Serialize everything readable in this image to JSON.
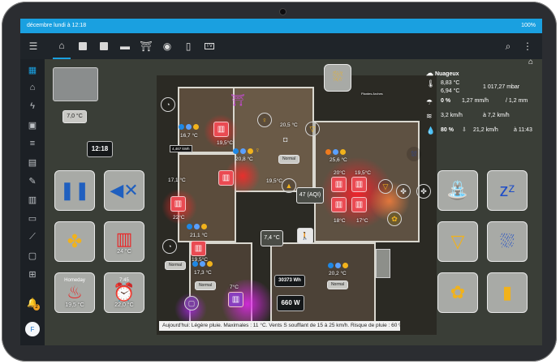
{
  "status": {
    "time_text": "décembre lundi à 12:18",
    "battery": "100%"
  },
  "weather": {
    "condition": "Nuageux",
    "temp_out": "8,83 °C",
    "dew_point": "6,94 °C",
    "pressure": "1 017,27 mbar",
    "rain_prob": "0 %",
    "rain_rate": "1,27 mm/h",
    "rain_total": "/ 1,2 mm",
    "wind": "3,2 km/h",
    "gust": "à 7,2 km/h",
    "humidity": "80 %",
    "wind_max": "21,2 km/h",
    "wind_max_time": "à 11:43"
  },
  "left": {
    "camera_temp": "7,0 °C",
    "clock": "12:18",
    "radiator_temp": "24 °C",
    "homeday_label": "Homeday",
    "homeday_temp": "19,5 °C",
    "alarm_time": "7:45",
    "alarm_temp": "22,0 °C"
  },
  "plan": {
    "plant_label": "Plantes Arches",
    "power_kwh": "4,467 kWh",
    "t1": "16,7 °C",
    "t2": "19,5°C",
    "t3": "20,8 °C",
    "t4": "20,5 °C",
    "t5": "17,1 °C",
    "t6": "22°C",
    "t7": "19,5°C",
    "t8": "25,6 °C",
    "t9": "20°C",
    "t10": "19,5°C",
    "t11": "18°C",
    "t12": "17°C",
    "t13": "21,1 °C",
    "t14": "19,5°C",
    "t15": "17,3 °C",
    "t16": "7°C",
    "t17": "20,2 °C",
    "t18": "7,4 °C",
    "aqi": "47 (AQI)",
    "energy_wh": "30373 Wh",
    "power_w": "660 W",
    "mode_1": "Normal",
    "mode_2": "Normal",
    "mode_3": "Normal",
    "mode_4": "Normal",
    "mode_5": "Normal"
  },
  "forecast": "Aujourd'hui: Légère pluie. Maximales : 11 °C. Vents S soufflant de 15 à 25 km/h. Risque de pluie : 60 %.",
  "user_initial": "F",
  "notif_count": "2",
  "colors": {
    "accent": "#1aa0e0",
    "yellow": "#f1b21c",
    "blue": "#1f4ec7"
  }
}
